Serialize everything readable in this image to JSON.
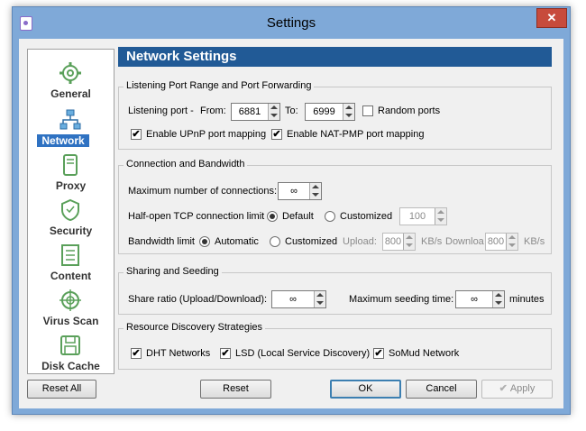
{
  "window": {
    "title": "Settings",
    "close_glyph": "✕"
  },
  "sidebar": {
    "items": [
      {
        "label": "General",
        "icon": "gear-icon"
      },
      {
        "label": "Network",
        "icon": "network-icon"
      },
      {
        "label": "Proxy",
        "icon": "proxy-icon"
      },
      {
        "label": "Security",
        "icon": "shield-icon"
      },
      {
        "label": "Content",
        "icon": "list-icon"
      },
      {
        "label": "Virus Scan",
        "icon": "crosshair-icon"
      },
      {
        "label": "Disk Cache",
        "icon": "floppy-icon"
      }
    ],
    "active": "Network"
  },
  "header": {
    "title": "Network Settings"
  },
  "ports": {
    "legend": "Listening Port Range and Port Forwarding",
    "listening_label": "Listening port -",
    "from_label": "From:",
    "from_value": "6881",
    "to_label": "To:",
    "to_value": "6999",
    "random_label": "Random ports",
    "random_checked": false,
    "upnp_label": "Enable UPnP port mapping",
    "upnp_checked": true,
    "natpmp_label": "Enable NAT-PMP port mapping",
    "natpmp_checked": true
  },
  "bandwidth": {
    "legend": "Connection and Bandwidth",
    "max_conn_label": "Maximum number of connections:",
    "max_conn_value": "∞",
    "halfopen_label": "Half-open TCP connection limit",
    "halfopen_default": "Default",
    "halfopen_custom": "Customized",
    "halfopen_value": "100",
    "bw_label": "Bandwidth limit",
    "bw_auto": "Automatic",
    "bw_custom": "Customized",
    "upload_label": "Upload:",
    "upload_value": "800",
    "upload_unit": "KB/s",
    "download_label": "Downloa",
    "download_value": "800",
    "download_unit": "KB/s"
  },
  "sharing": {
    "legend": "Sharing and Seeding",
    "ratio_label": "Share ratio (Upload/Download):",
    "ratio_value": "∞",
    "max_time_label": "Maximum seeding time:",
    "max_time_value": "∞",
    "max_time_unit": "minutes"
  },
  "discovery": {
    "legend": "Resource Discovery Strategies",
    "dht_label": "DHT Networks",
    "dht_checked": true,
    "lsd_label": "LSD (Local Service Discovery)",
    "lsd_checked": true,
    "somud_label": "SoMud Network",
    "somud_checked": true
  },
  "buttons": {
    "reset_all": "Reset All",
    "reset": "Reset",
    "ok": "OK",
    "cancel": "Cancel",
    "apply": "Apply"
  },
  "colors": {
    "header_bg": "#215a96",
    "active_bg": "#2f72c2",
    "frame": "#7fa9d8",
    "close": "#c74b3c"
  }
}
